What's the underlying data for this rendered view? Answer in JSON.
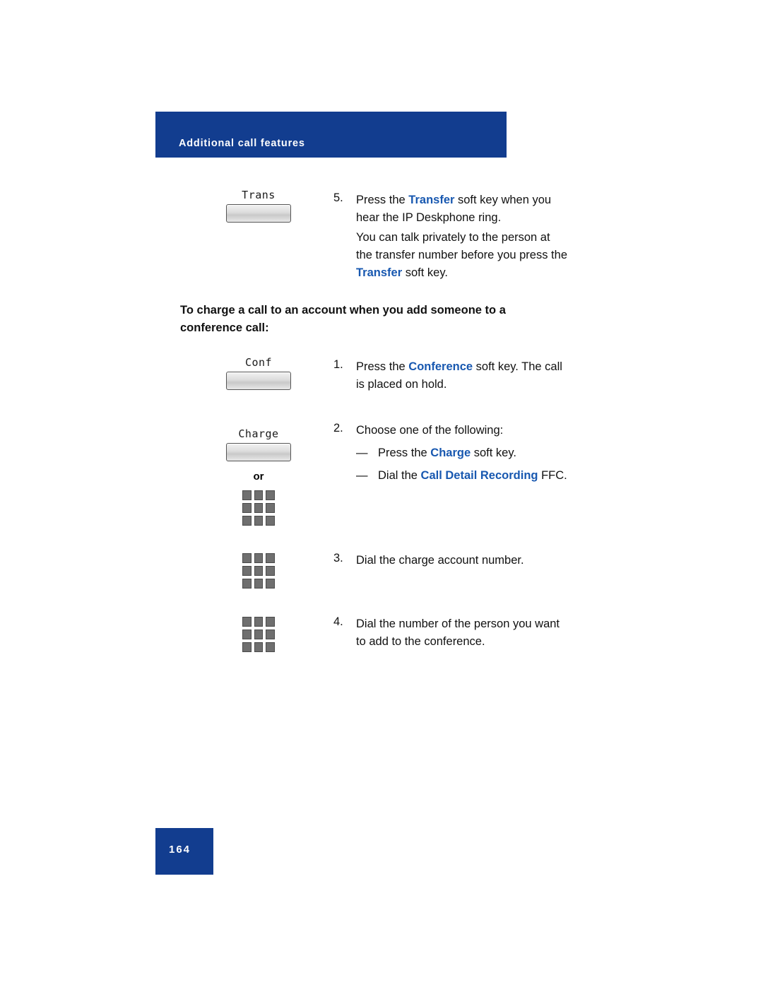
{
  "header": {
    "title": "Additional call features"
  },
  "footer": {
    "page_number": "164"
  },
  "icons": {
    "trans_key_label": "Trans",
    "conf_key_label": "Conf",
    "charge_key_label": "Charge",
    "or_label": "or"
  },
  "steps": {
    "s5_num": "5.",
    "s5_line1_pre": "Press the ",
    "s5_line1_bold": "Transfer",
    "s5_line1_post": " soft key when you",
    "s5_line2": "hear the IP Deskphone ring.",
    "s5_para_line1": "You can talk privately to the person at",
    "s5_para_line2": "the transfer number before you press the",
    "s5_para_line3_bold": "Transfer",
    "s5_para_line3_post": " soft key.",
    "section_head_line1": "To charge a call to an account when you add someone to a",
    "section_head_line2": "conference call:",
    "s1_num": "1.",
    "s1_line1_pre": "Press the ",
    "s1_line1_bold": "Conference",
    "s1_line1_post": " soft key. The call",
    "s1_line2": "is placed on hold.",
    "s2_num": "2.",
    "s2_line1": "Choose one of the following:",
    "bullet1_dash": "—",
    "bullet1_pre": "Press the ",
    "bullet1_bold": "Charge",
    "bullet1_post": " soft key.",
    "bullet2_dash": "—",
    "bullet2_pre": "Dial the ",
    "bullet2_bold": "Call Detail Recording",
    "bullet2_post": " FFC.",
    "s3_num": "3.",
    "s3_line1": "Dial the charge account number.",
    "s4_num": "4.",
    "s4_line1": "Dial the number of the person you want",
    "s4_line2": "to add to the conference."
  },
  "colors": {
    "brand_blue": "#123d8f",
    "accent_blue": "#1858b0"
  }
}
